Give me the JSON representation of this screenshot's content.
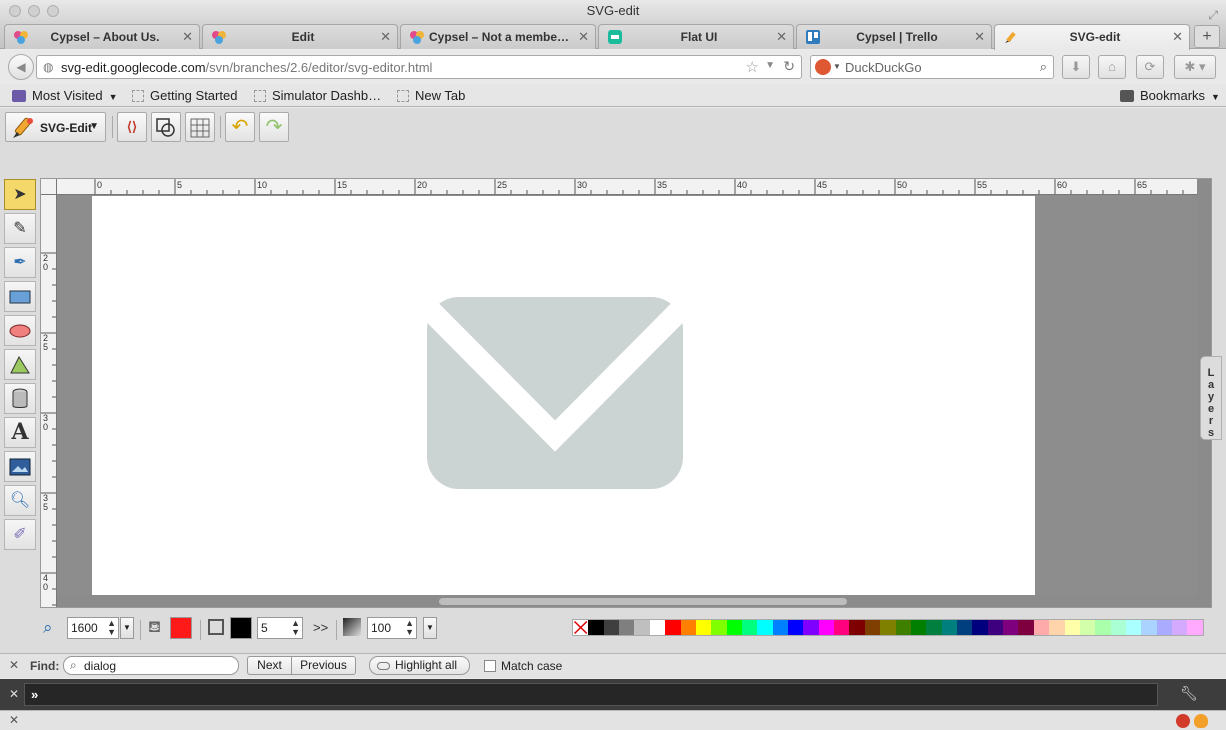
{
  "window": {
    "title": "SVG-edit"
  },
  "tabs": [
    {
      "label": "Cypsel – About Us.",
      "active": false
    },
    {
      "label": "Edit",
      "active": false
    },
    {
      "label": "Cypsel – Not a member…",
      "active": false
    },
    {
      "label": "Flat UI",
      "active": false
    },
    {
      "label": "Cypsel | Trello",
      "active": false
    },
    {
      "label": "SVG-edit",
      "active": true
    }
  ],
  "nav": {
    "url_host": "svg-edit.googlecode.com",
    "url_path": "/svn/branches/2.6/editor/svg-editor.html",
    "search_placeholder": "DuckDuckGo"
  },
  "bookmarks": {
    "most_visited": "Most Visited",
    "items": [
      "Getting Started",
      "Simulator Dashb…",
      "New Tab"
    ],
    "bookmarks_menu": "Bookmarks"
  },
  "editor": {
    "menu_label": "SVG-Edit",
    "layers_label": "Layers",
    "ruler_h_labels": [
      "0",
      "5",
      "10",
      "15",
      "20",
      "25",
      "30",
      "35",
      "40",
      "45",
      "50",
      "55",
      "60",
      "65"
    ],
    "ruler_v_labels": [
      "20",
      "25",
      "30",
      "35",
      "40"
    ],
    "zoom_value": "1600",
    "stroke_width": "5",
    "opacity": "100",
    "colors": {
      "fill": "#ff1a1a",
      "stroke": "#000000",
      "envelope": "#ccd3d3",
      "selected_tool": "#f5d86a"
    },
    "palette": [
      "#000000",
      "#3f3f3f",
      "#7f7f7f",
      "#bfbfbf",
      "#ffffff",
      "#ff0000",
      "#ff7f00",
      "#ffff00",
      "#7fff00",
      "#00ff00",
      "#00ff7f",
      "#00ffff",
      "#007fff",
      "#0000ff",
      "#7f00ff",
      "#ff00ff",
      "#ff007f",
      "#7f0000",
      "#7f3f00",
      "#7f7f00",
      "#3f7f00",
      "#007f00",
      "#007f3f",
      "#007f7f",
      "#003f7f",
      "#00007f",
      "#3f007f",
      "#7f007f",
      "#7f003f",
      "#ffaaaa",
      "#ffd4aa",
      "#ffffaa",
      "#d4ffaa",
      "#aaffaa",
      "#aaffd4",
      "#aaffff",
      "#aad4ff",
      "#aaaaff",
      "#d4aaff",
      "#ffaaff"
    ]
  },
  "findbar": {
    "label": "Find:",
    "query": "dialog",
    "next": "Next",
    "previous": "Previous",
    "highlight_all": "Highlight all",
    "match_case": "Match case"
  },
  "console": {
    "prompt": "»"
  }
}
